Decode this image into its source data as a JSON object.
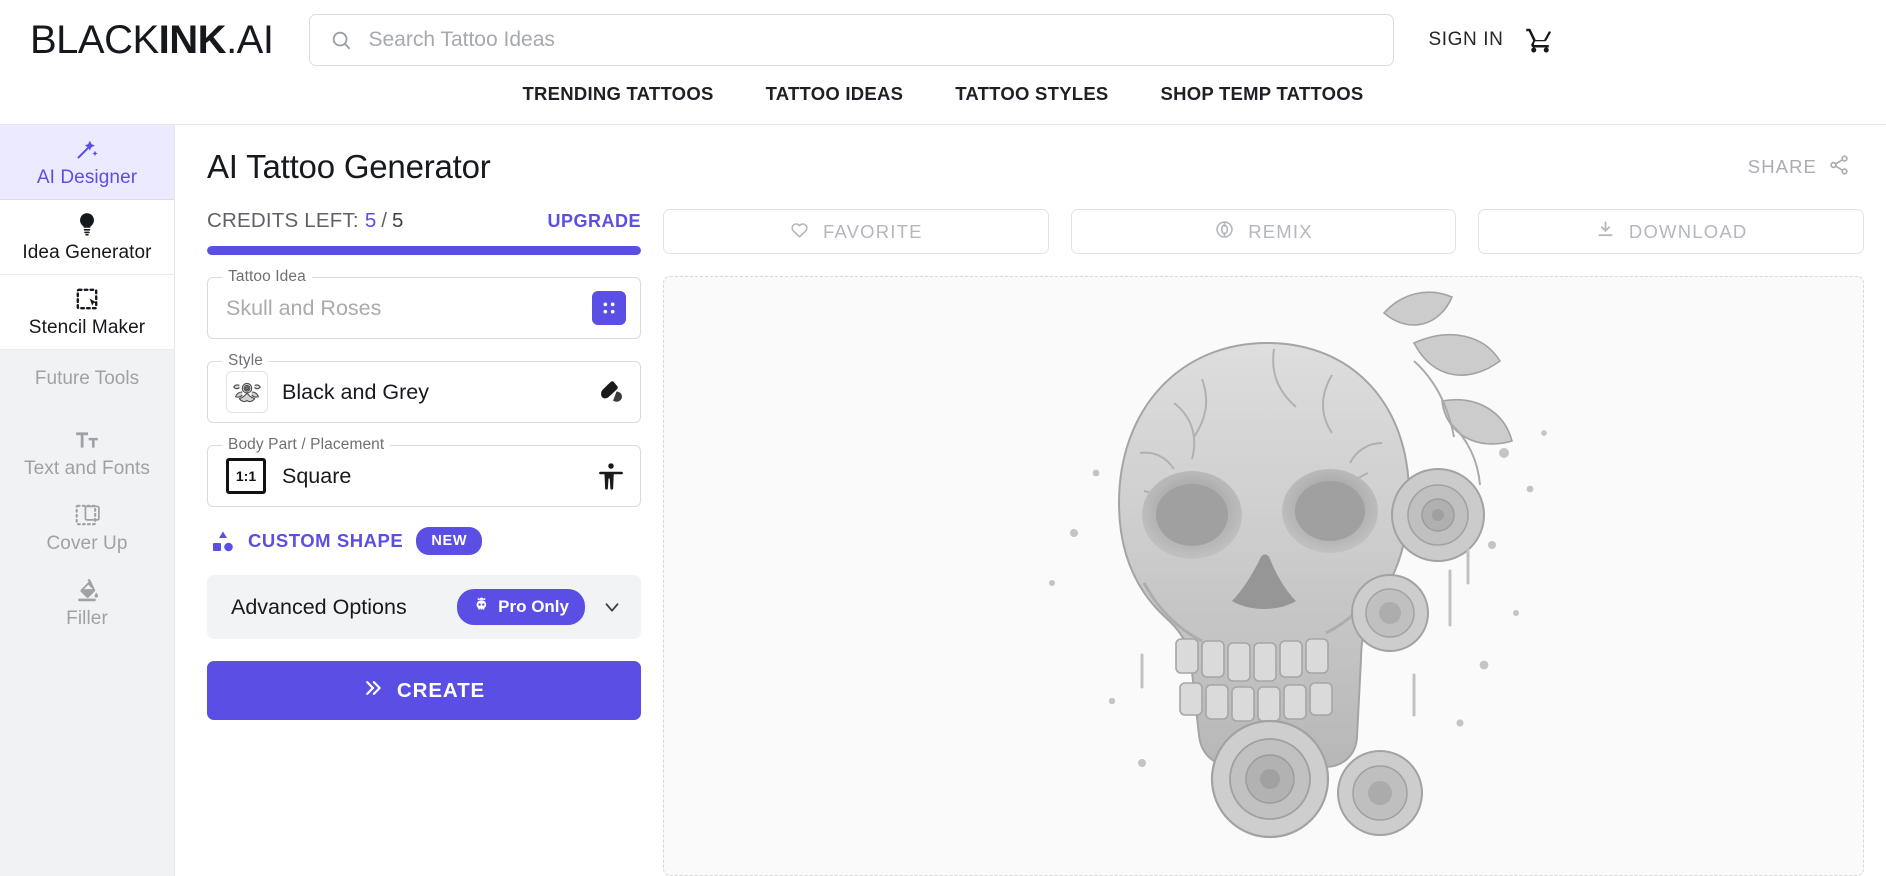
{
  "header": {
    "logo_light": "BLACK",
    "logo_bold": "INK",
    "logo_tail": ".AI",
    "search_placeholder": "Search Tattoo Ideas",
    "search_value": "",
    "search_icon": "search-icon",
    "signin_label": "SIGN IN",
    "cart_icon": "shopping-cart-icon"
  },
  "nav": {
    "items": [
      {
        "label": "TRENDING TATTOOS"
      },
      {
        "label": "TATTOO IDEAS"
      },
      {
        "label": "TATTOO STYLES"
      },
      {
        "label": "SHOP TEMP TATTOOS"
      }
    ]
  },
  "sidebar": {
    "items": [
      {
        "label": "AI Designer",
        "icon": "magic-wand-icon",
        "active": true
      },
      {
        "label": "Idea Generator",
        "icon": "lightbulb-icon",
        "active": false
      },
      {
        "label": "Stencil Maker",
        "icon": "selection-cursor-icon",
        "active": false
      }
    ],
    "future_heading": "Future Tools",
    "future_items": [
      {
        "label": "Text and Fonts",
        "icon": "text-format-icon"
      },
      {
        "label": "Cover Up",
        "icon": "cover-up-square-icon"
      },
      {
        "label": "Filler",
        "icon": "paint-bucket-icon"
      }
    ]
  },
  "main": {
    "title": "AI Tattoo Generator",
    "share_label": "SHARE",
    "share_icon": "share-icon"
  },
  "credits": {
    "label": "CREDITS LEFT:",
    "value": "5",
    "separator": "/",
    "total": "5",
    "upgrade_label": "UPGRADE",
    "progress_percent": 100,
    "accent_color": "#5b4ee5"
  },
  "form": {
    "tattoo_idea": {
      "legend": "Tattoo Idea",
      "placeholder": "Skull and Roses",
      "value": "",
      "action_icon": "dice-icon"
    },
    "style": {
      "legend": "Style",
      "value": "Black and Grey",
      "thumb_icon": "rose-thumbnail-icon",
      "action_icon": "ink-blob-icon"
    },
    "body_part": {
      "legend": "Body Part / Placement",
      "value": "Square",
      "ratio_label": "1:1",
      "action_icon": "body-figure-icon"
    },
    "custom_shape": {
      "label": "CUSTOM SHAPE",
      "badge": "NEW",
      "icon": "shapes-icon"
    },
    "advanced": {
      "label": "Advanced Options",
      "badge": "Pro Only",
      "badge_icon": "crown-skull-icon",
      "chevron_icon": "chevron-down-icon"
    },
    "create_button": {
      "label": "CREATE",
      "icon": "double-chevron-right-icon"
    }
  },
  "result_actions": [
    {
      "label": "FAVORITE",
      "icon": "heart-icon"
    },
    {
      "label": "REMIX",
      "icon": "remix-icon"
    },
    {
      "label": "DOWNLOAD",
      "icon": "download-icon"
    }
  ],
  "preview": {
    "alt": "skull-and-roses-tattoo-artwork"
  },
  "colors": {
    "accent": "#5b4ee5",
    "accent_soft": "#eceaff",
    "muted_text": "#9ea2a7",
    "border": "#d8dadd"
  }
}
